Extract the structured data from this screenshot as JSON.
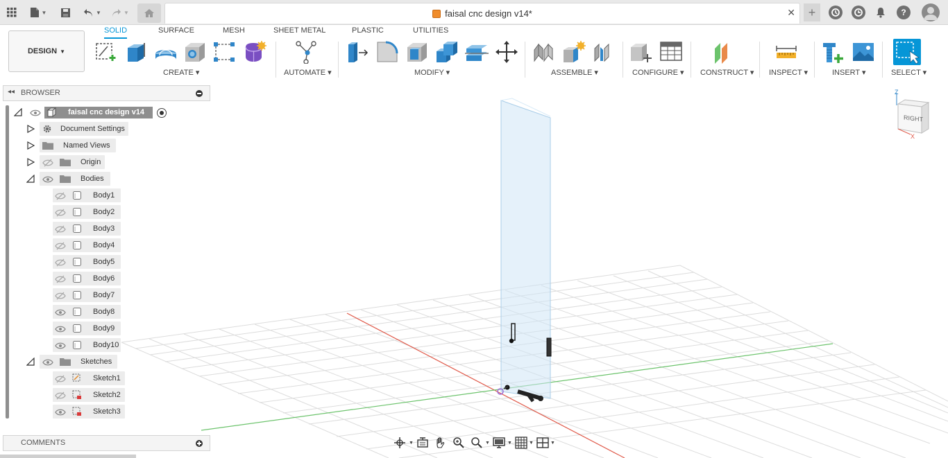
{
  "window": {
    "document_title": "faisal cnc design v14*"
  },
  "titlebar": {
    "icons": [
      "grid-menu-icon",
      "file-icon",
      "save-icon",
      "undo-icon",
      "redo-icon",
      "home-icon",
      "new-tab-icon",
      "job-status-icon",
      "history-icon",
      "notifications-icon",
      "help-icon",
      "user-avatar"
    ]
  },
  "ribbon": {
    "workspace_label": "DESIGN",
    "tabs": [
      {
        "label": "SOLID",
        "active": true
      },
      {
        "label": "SURFACE",
        "active": false
      },
      {
        "label": "MESH",
        "active": false
      },
      {
        "label": "SHEET METAL",
        "active": false
      },
      {
        "label": "PLASTIC",
        "active": false
      },
      {
        "label": "UTILITIES",
        "active": false
      }
    ],
    "groups": {
      "create": "CREATE",
      "automate": "AUTOMATE",
      "modify": "MODIFY",
      "assemble": "ASSEMBLE",
      "configure": "CONFIGURE",
      "construct": "CONSTRUCT",
      "inspect": "INSPECT",
      "insert": "INSERT",
      "select": "SELECT"
    }
  },
  "browser": {
    "title": "BROWSER",
    "root": "faisal cnc design v14",
    "items": [
      {
        "label": "Document Settings"
      },
      {
        "label": "Named Views"
      },
      {
        "label": "Origin"
      },
      {
        "label": "Bodies"
      }
    ],
    "bodies": [
      "Body1",
      "Body2",
      "Body3",
      "Body4",
      "Body5",
      "Body6",
      "Body7",
      "Body8",
      "Body9",
      "Body10"
    ],
    "sketches_folder": "Sketches",
    "sketches": [
      "Sketch1",
      "Sketch2",
      "Sketch3"
    ]
  },
  "comments": {
    "title": "COMMENTS"
  },
  "viewcube": {
    "face": "RIGHT",
    "axis_z": "Z",
    "axis_x": "X"
  },
  "colors": {
    "accent": "#0696d7",
    "x_axis": "#e05a4a",
    "y_axis": "#6cc36c",
    "plane": "#cfe6f5"
  }
}
